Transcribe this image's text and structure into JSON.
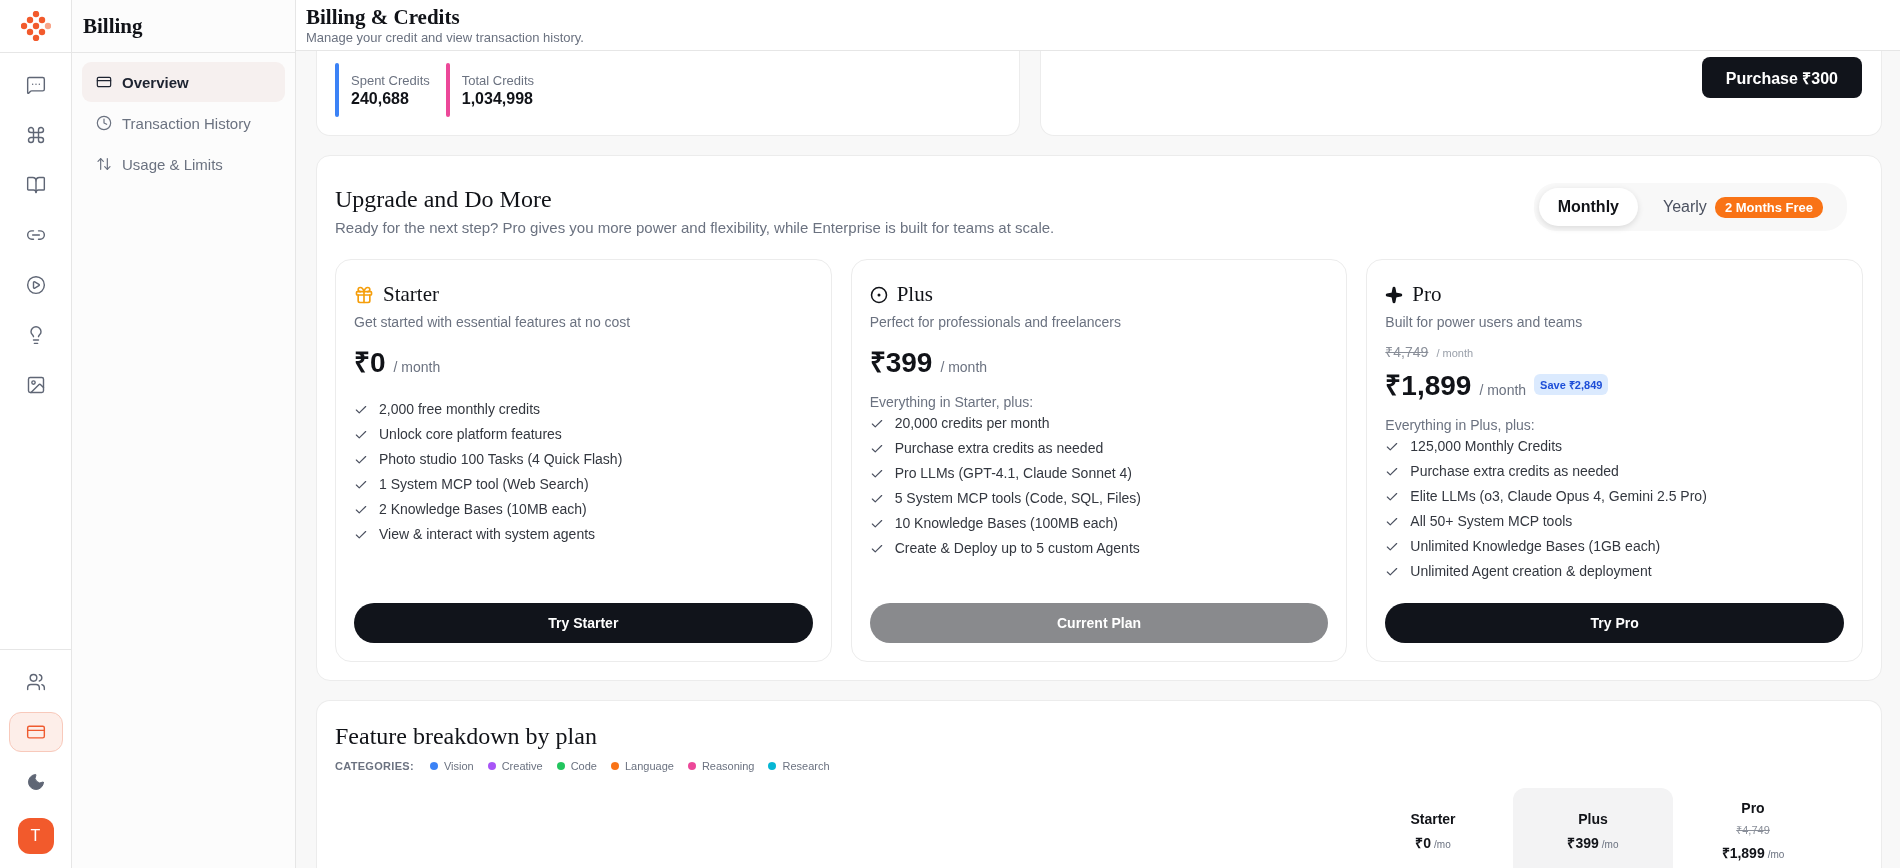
{
  "rail": {
    "top": [
      {
        "selected": false
      },
      {
        "selected": false
      },
      {
        "selected": false
      },
      {
        "selected": false
      },
      {
        "selected": false
      },
      {
        "selected": false
      },
      {
        "selected": false
      }
    ],
    "bottom": [
      {
        "selected": false
      },
      {
        "selected": true
      }
    ],
    "avatar": "T"
  },
  "subnav": {
    "title": "Billing",
    "items": [
      {
        "label": "Overview",
        "selected": true
      },
      {
        "label": "Transaction History",
        "selected": false
      },
      {
        "label": "Usage & Limits",
        "selected": false
      }
    ]
  },
  "header": {
    "title": "Billing & Credits",
    "subtitle": "Manage your credit and view transaction history."
  },
  "credits": [
    {
      "label": "Spent Credits",
      "value": "240,688",
      "color": "#3b82f6"
    },
    {
      "label": "Total Credits",
      "value": "1,034,998",
      "color": "#ec4899"
    }
  ],
  "purchase_button": "Purchase ₹300",
  "upgrade": {
    "title": "Upgrade and Do More",
    "subtitle": "Ready for the next step? Pro gives you more power and flexibility, while Enterprise is built for teams at scale.",
    "periods": [
      {
        "label": "Monthly",
        "selected": true
      },
      {
        "label": "Yearly",
        "selected": false,
        "badge": "2 Months Free"
      }
    ],
    "plans": [
      {
        "name": "Starter",
        "description": "Get started with essential features at no cost",
        "price": "₹0",
        "unit": "/ month",
        "features": [
          "2,000 free monthly credits",
          "Unlock core platform features",
          "Photo studio 100 Tasks (4 Quick Flash)",
          "1 System MCP tool (Web Search)",
          "2 Knowledge Bases (10MB each)",
          "View & interact with system agents"
        ],
        "button": "Try Starter",
        "current": false
      },
      {
        "name": "Plus",
        "description": "Perfect for professionals and freelancers",
        "price": "₹399",
        "unit": "/ month",
        "features_intro": "Everything in Starter, plus:",
        "features": [
          "20,000 credits per month",
          "Purchase extra credits as needed",
          "Pro LLMs (GPT-4.1, Claude Sonnet 4)",
          "5 System MCP tools (Code, SQL, Files)",
          "10 Knowledge Bases (100MB each)",
          "Create & Deploy up to 5 custom Agents"
        ],
        "button": "Current Plan",
        "current": true
      },
      {
        "name": "Pro",
        "description": "Built for power users and teams",
        "old_price": "₹4,749",
        "old_unit": "/ month",
        "price": "₹1,899",
        "unit": "/ month",
        "save_badge": "Save ₹2,849",
        "features_intro": "Everything in Plus, plus:",
        "features": [
          "125,000 Monthly Credits",
          "Purchase extra credits as needed",
          "Elite LLMs (o3, Claude Opus 4, Gemini 2.5 Pro)",
          "All 50+ System MCP tools",
          "Unlimited Knowledge Bases (1GB each)",
          "Unlimited Agent creation & deployment"
        ],
        "button": "Try Pro",
        "current": false
      }
    ]
  },
  "breakdown": {
    "title": "Feature breakdown by plan",
    "categories_label": "CATEGORIES:",
    "categories": [
      {
        "label": "Vision",
        "color": "#3b82f6"
      },
      {
        "label": "Creative",
        "color": "#a855f7"
      },
      {
        "label": "Code",
        "color": "#22c55e"
      },
      {
        "label": "Language",
        "color": "#f97316"
      },
      {
        "label": "Reasoning",
        "color": "#ec4899"
      },
      {
        "label": "Research",
        "color": "#06b6d4"
      }
    ],
    "columns": [
      {
        "name": "Starter",
        "price": "₹0",
        "unit": "/mo",
        "current": false
      },
      {
        "name": "Plus",
        "price": "₹399",
        "unit": "/mo",
        "current": true
      },
      {
        "name": "Pro",
        "old_price": "₹4,749",
        "price": "₹1,899",
        "unit": "/mo",
        "current": false
      }
    ]
  }
}
